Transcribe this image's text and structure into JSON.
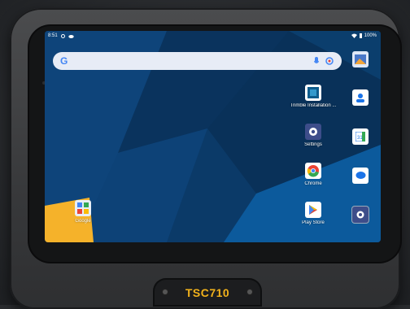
{
  "status_bar": {
    "time": "8:51",
    "battery": "100%"
  },
  "search": {
    "logo": "G"
  },
  "apps": [
    {
      "id": "trimble",
      "label": "Trimble Installation ...",
      "icon": "trimble-installation-icon"
    },
    {
      "id": "settings",
      "label": "Settings",
      "icon": "gear-icon"
    },
    {
      "id": "chrome",
      "label": "Chrome",
      "icon": "chrome-icon"
    },
    {
      "id": "playstore",
      "label": "Play Store",
      "icon": "play-store-icon"
    },
    {
      "id": "google",
      "label": "Google",
      "icon": "google-folder-icon"
    }
  ],
  "side_rail": [
    {
      "icon": "gallery-icon"
    },
    {
      "icon": "contacts-icon"
    },
    {
      "icon": "calendar-icon"
    },
    {
      "icon": "messages-icon"
    },
    {
      "icon": "settings-icon"
    }
  ],
  "device": {
    "model": "TSC710"
  },
  "colors": {
    "brand": "#f2b21b",
    "wallpaper": "#0d3d6e",
    "accent_yellow": "#f5b22a"
  }
}
